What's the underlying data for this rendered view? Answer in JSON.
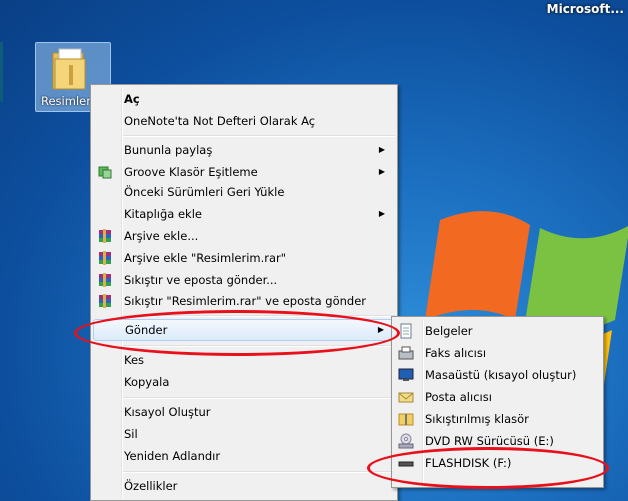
{
  "window_title": "Microsoft...",
  "desktop_icon": {
    "label": "Resimler"
  },
  "context_menu": {
    "items": [
      {
        "label": "Aç",
        "bold": true
      },
      {
        "label": "OneNote'ta Not Defteri Olarak Aç"
      },
      {
        "label": "Bununla paylaş",
        "submenu": true
      },
      {
        "label": "Groove Klasör Eşitleme",
        "submenu": true,
        "icon": "groove-icon"
      },
      {
        "label": "Önceki Sürümleri Geri Yükle"
      },
      {
        "label": "Kitaplığa ekle",
        "submenu": true
      },
      {
        "label": "Arşive ekle...",
        "icon": "winrar-icon"
      },
      {
        "label": "Arşive ekle \"Resimlerim.rar\"",
        "icon": "winrar-icon"
      },
      {
        "label": "Sıkıştır ve eposta gönder...",
        "icon": "winrar-icon"
      },
      {
        "label": "Sıkıştır \"Resimlerim.rar\" ve eposta gönder",
        "icon": "winrar-icon"
      },
      {
        "label": "Gönder",
        "submenu": true,
        "highlighted": true
      },
      {
        "label": "Kes"
      },
      {
        "label": "Kopyala"
      },
      {
        "label": "Kısayol Oluştur"
      },
      {
        "label": "Sil"
      },
      {
        "label": "Yeniden Adlandır"
      },
      {
        "label": "Özellikler"
      }
    ]
  },
  "sendto_menu": {
    "items": [
      {
        "label": "Belgeler",
        "icon": "documents-icon"
      },
      {
        "label": "Faks alıcısı",
        "icon": "fax-icon"
      },
      {
        "label": "Masaüstü (kısayol oluştur)",
        "icon": "desktop-icon"
      },
      {
        "label": "Posta alıcısı",
        "icon": "mail-icon"
      },
      {
        "label": "Sıkıştırılmış klasör",
        "icon": "zip-folder-icon"
      },
      {
        "label": "DVD RW Sürücüsü (E:)",
        "icon": "dvd-drive-icon"
      },
      {
        "label": "FLASHDISK (F:)",
        "icon": "usb-drive-icon"
      }
    ]
  },
  "colors": {
    "annotation": "#e8101a",
    "highlight": "#dcebfc"
  }
}
